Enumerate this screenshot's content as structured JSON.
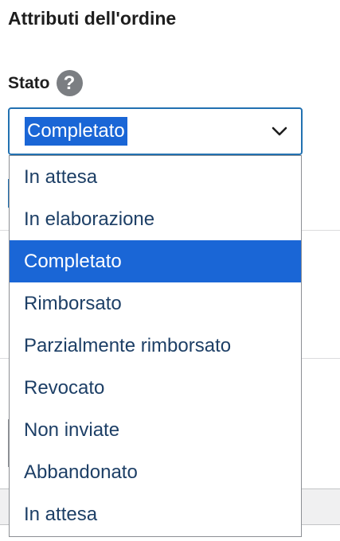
{
  "panel": {
    "title": "Attributi dell'ordine"
  },
  "status_field": {
    "label": "Stato",
    "help_icon": "question-mark-icon",
    "selected_value": "Completato",
    "options": [
      "In attesa",
      "In elaborazione",
      "Completato",
      "Rimborsato",
      "Parzialmente rimborsato",
      "Revocato",
      "Non inviate",
      "Abbandonato",
      "In attesa"
    ],
    "selected_index": 2
  },
  "colors": {
    "accent": "#1a66d6",
    "focus_border": "#2271b1",
    "option_text": "#1d3f66"
  }
}
